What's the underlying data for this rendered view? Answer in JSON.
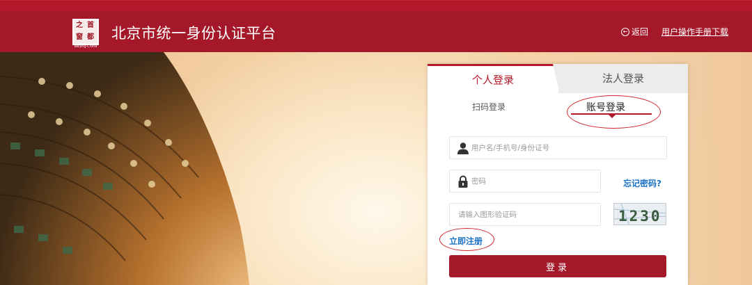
{
  "header": {
    "logo_glyphs": [
      "首",
      "都",
      "之",
      "窗"
    ],
    "logo_subtitle": "Beijing·China",
    "title": "北京市统一身份认证平台",
    "back_label": "返回",
    "manual_label": "用户操作手册下载"
  },
  "login": {
    "tabs": [
      "个人登录",
      "法人登录"
    ],
    "subtabs": [
      "扫码登录",
      "账号登录"
    ],
    "username_placeholder": "用户名/手机号/身份证号",
    "password_placeholder": "密码",
    "forgot_label": "忘记密码?",
    "captcha_placeholder": "请输入图形验证码",
    "captcha_text": "1230",
    "register_label": "立即注册",
    "submit_label": "登录"
  },
  "colors": {
    "brand_red": "#a5182a",
    "link_blue": "#1b72c7",
    "annotation_red": "#d0232a"
  }
}
